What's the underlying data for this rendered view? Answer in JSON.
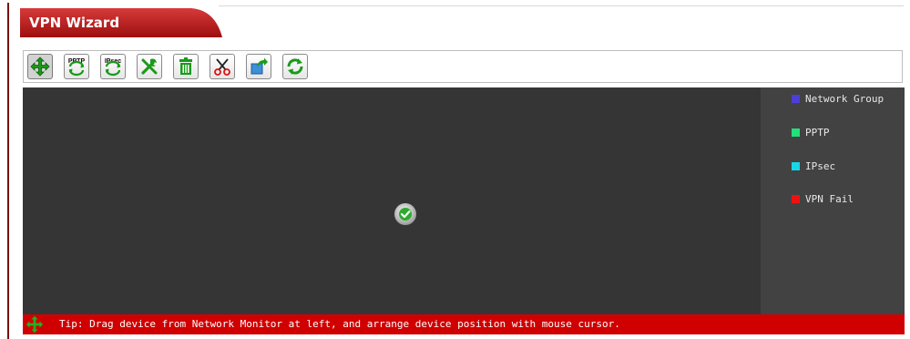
{
  "window": {
    "title": "VPN Wizard"
  },
  "toolbar": {
    "buttons": [
      {
        "icon": "move-icon"
      },
      {
        "icon": "pptp-icon",
        "label": "PPTP"
      },
      {
        "icon": "ipsec-icon",
        "label": "IPsec"
      },
      {
        "icon": "tools-icon"
      },
      {
        "icon": "trash-icon"
      },
      {
        "icon": "scissors-icon"
      },
      {
        "icon": "export-icon"
      },
      {
        "icon": "refresh-icon"
      }
    ]
  },
  "legend": {
    "items": [
      {
        "label": "Network Group",
        "color": "#4b3fd8"
      },
      {
        "label": "PPTP",
        "color": "#22e07a"
      },
      {
        "label": "IPsec",
        "color": "#19d6e6"
      },
      {
        "label": "VPN Fail",
        "color": "#ee1111"
      }
    ]
  },
  "tip": {
    "text": "Tip: Drag device from Network Monitor at left, and arrange device position with mouse cursor."
  },
  "colors": {
    "brand_red": "#b81414",
    "canvas": "#353535",
    "legend_bg": "#424242",
    "tip_bar": "#d00000"
  }
}
